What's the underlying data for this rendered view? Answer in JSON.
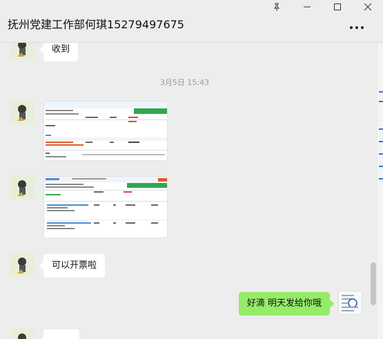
{
  "window": {
    "title": "抚州党建工作部何琪15279497675"
  },
  "messages": {
    "msg1_text": "收到",
    "timestamp": "3月5日 15:43",
    "msg4_text": "可以开票啦",
    "msg5_text": "好滴 明天发给你哦"
  },
  "icons": {
    "pin": "pin-icon",
    "minimize": "minimize-icon",
    "maximize": "maximize-icon",
    "close": "close-icon",
    "more": "more-icon"
  },
  "colors": {
    "outgoing_bubble": "#95ec69",
    "incoming_bubble": "#ffffff",
    "background": "#ededed",
    "accent_green": "#2fa84f"
  }
}
